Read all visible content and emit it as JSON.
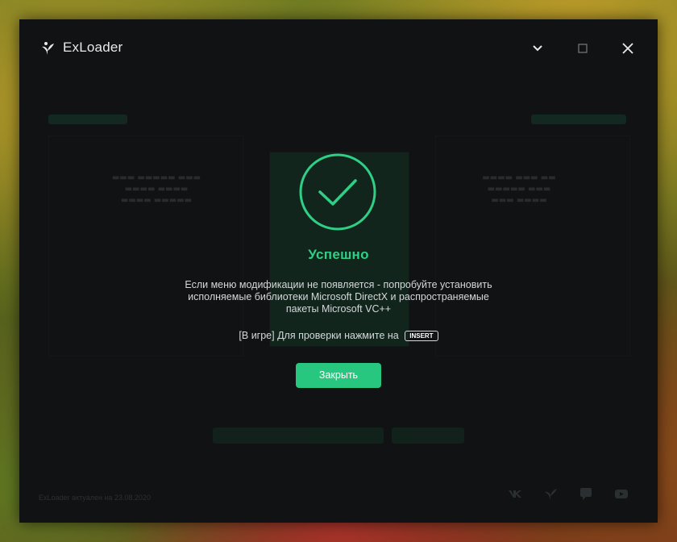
{
  "window": {
    "title": "ExLoader",
    "controls": {
      "collapse_icon": "chevron-down-icon",
      "maximize_icon": "square-icon",
      "close_icon": "close-icon"
    }
  },
  "footer": {
    "status": "ExLoader актуален на 23.08.2020",
    "social_icons": [
      "vk-icon",
      "exloader-icon",
      "chat-icon",
      "youtube-icon"
    ]
  },
  "dialog": {
    "title": "Успешно",
    "message": "Если меню модификации не появляется - попробуйте установить исполняемые библиотеки Microsoft DirectX и распространяемые пакеты Microsoft VC++",
    "hint": "[В игре] Для проверки нажмите на",
    "key": "INSERT",
    "button": "Закрыть"
  },
  "colors": {
    "accent": "#27c77f",
    "success_text": "#2fcf86",
    "window_bg": "#101213",
    "text": "#d4d8da"
  }
}
